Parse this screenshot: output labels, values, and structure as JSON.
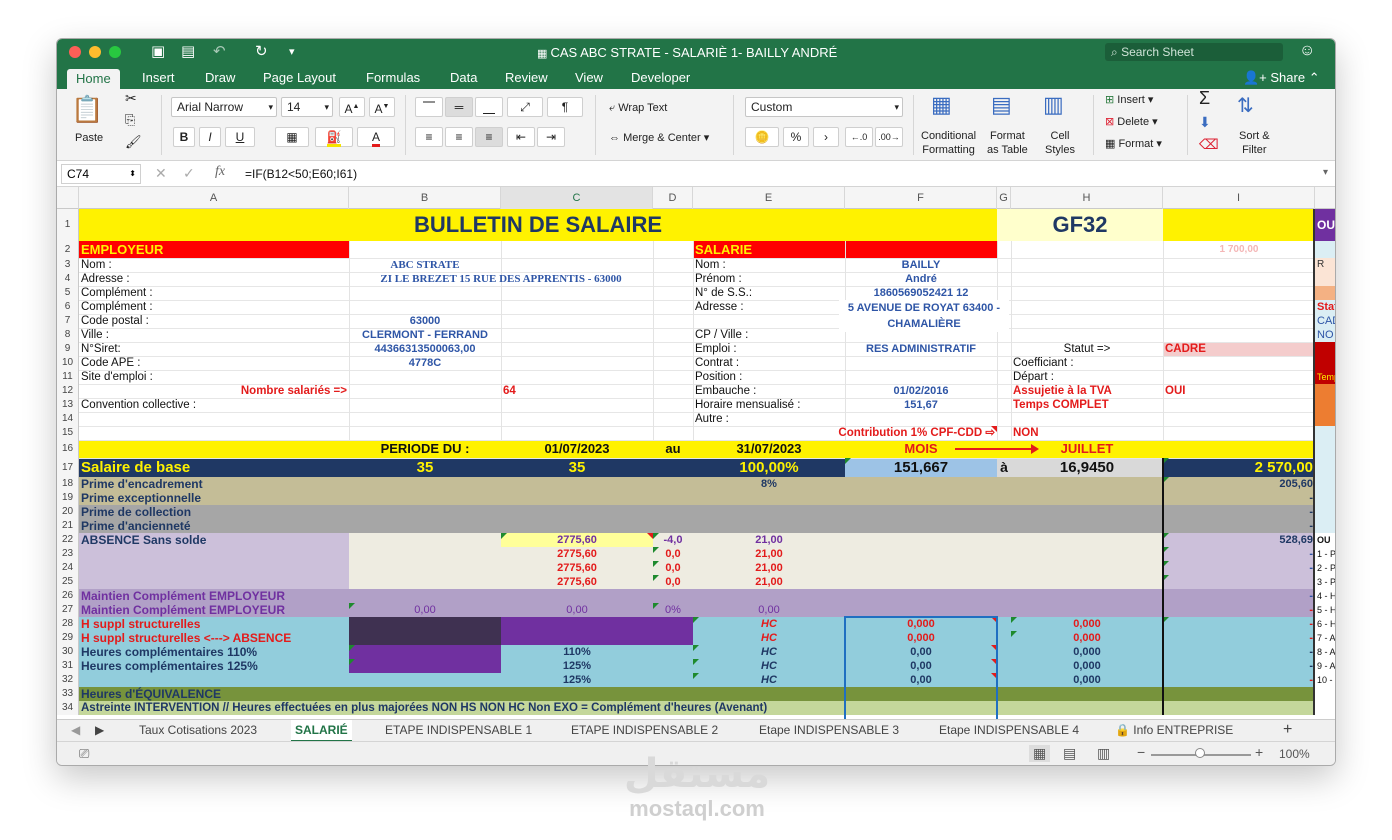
{
  "window": {
    "title": "CAS ABC STRATE - SALARIÈ 1- BAILLY ANDRÉ",
    "search_placeholder": "Search Sheet",
    "share_label": "Share"
  },
  "ribbon_tabs": [
    "Home",
    "Insert",
    "Draw",
    "Page Layout",
    "Formulas",
    "Data",
    "Review",
    "View",
    "Developer"
  ],
  "ribbon": {
    "paste": "Paste",
    "font_name": "Arial Narrow",
    "font_size": "14",
    "bold": "B",
    "italic": "I",
    "underline": "U",
    "wrap_text": "Wrap Text",
    "merge_center": "Merge & Center",
    "number_format": "Custom",
    "percent": "%",
    "comma": "›",
    "cond_formatting_1": "Conditional",
    "cond_formatting_2": "Formatting",
    "format_table_1": "Format",
    "format_table_2": "as Table",
    "cell_styles_1": "Cell",
    "cell_styles_2": "Styles",
    "insert": "Insert",
    "delete": "Delete",
    "format": "Format",
    "sort_filter_1": "Sort &",
    "sort_filter_2": "Filter"
  },
  "formula_bar": {
    "name_box": "C74",
    "fx": "fx",
    "formula": "=IF(B12<50;E60;I61)"
  },
  "columns": [
    "A",
    "B",
    "C",
    "D",
    "E",
    "F",
    "G",
    "H",
    "I"
  ],
  "rows": [
    "1",
    "2",
    "3",
    "4",
    "5",
    "6",
    "7",
    "8",
    "9",
    "10",
    "11",
    "12",
    "13",
    "14",
    "15",
    "16",
    "17",
    "18",
    "19",
    "20",
    "21",
    "22",
    "23",
    "24",
    "25",
    "26",
    "27",
    "28",
    "29",
    "30",
    "31",
    "32",
    "33",
    "34"
  ],
  "sheet": {
    "title": "BULLETIN DE SALAIRE",
    "code": "GF32",
    "right_edge": {
      "r1": "OU",
      "r3": "R",
      "r6": "Stat",
      "r7": "CAD",
      "r8": "NO",
      "r11": "Temps C",
      "r22": "OU",
      "r23": "1 - P",
      "r24": "2 - P",
      "r25": "3 - P",
      "r26": "4 - H",
      "r27": "5 - H",
      "r28": "6 - H",
      "r29": "7 - A",
      "r30": "8 - A",
      "r31": "9 - A",
      "r32": "10 -"
    },
    "employeur": "EMPLOYEUR",
    "salarie": "SALARIE",
    "amount_top": "1 700,00",
    "labels_left": [
      "Nom :",
      "Adresse :",
      "Complément :",
      "Complément :",
      "Code postal :",
      "Ville :",
      "N°Siret:",
      "Code APE :",
      "Site d'emploi :"
    ],
    "nb_salaries_label": "Nombre salariés =>",
    "nb_salaries": "64",
    "convention": "Convention collective :",
    "company_name": "ABC STRATE",
    "company_address": "ZI LE BREZET 15 RUE DES APPRENTIS - 63000",
    "company_cp": "63000",
    "company_city": "CLERMONT - FERRAND",
    "company_siret": "44366313500063,00",
    "company_ape": "4778C",
    "labels_mid": [
      "Nom :",
      "Prénom :",
      "N° de S.S.:",
      "Adresse :",
      "",
      "CP / Ville :",
      "Emploi :",
      "Contrat :",
      "Position :",
      "Embauche :",
      "Horaire mensualisé :",
      "Autre :"
    ],
    "emp_nom": "BAILLY",
    "emp_prenom": "André",
    "emp_ss": "1860569052421 12",
    "emp_addr_1": "5 AVENUE DE ROYAT 63400 -",
    "emp_addr_2": "CHAMALIÈRE",
    "emp_emploi": "RES ADMINISTRATIF",
    "emp_embauche": "01/02/2016",
    "emp_horaire": "151,67",
    "statut_label": "Statut =>",
    "statut": "CADRE",
    "coefficient": "Coefficiant :",
    "depart": "Départ :",
    "tva_label": "Assujetie à la TVA",
    "tva": "OUI",
    "temps": "Temps COMPLET",
    "contribution": "Contribution 1% CPF-CDD ⇨",
    "non": "NON",
    "periode_label": "PERIODE DU :",
    "periode_start": "01/07/2023",
    "periode_au": "au",
    "periode_end": "31/07/2023",
    "mois_label": "MOIS",
    "mois": "JUILLET",
    "salaire_label": "Salaire de base",
    "salaire_b": "35",
    "salaire_c": "35",
    "salaire_pct": "100,00%",
    "salaire_hours": "151,667",
    "salaire_a": "à",
    "salaire_rate": "16,9450",
    "salaire_total": "2 570,00",
    "r18_label": "Prime d'encadrement",
    "r18_pct": "8%",
    "r18_val": "205,60",
    "r19_label": "Prime exceptionnelle",
    "r20_label": "Prime de collection",
    "r21_label": "Prime d'ancienneté",
    "r22_label": "ABSENCE Sans solde",
    "dash": "-",
    "abs_c": [
      "2775,60",
      "2775,60",
      "2775,60",
      "2775,60"
    ],
    "abs_d": [
      "-4,0",
      "0,0",
      "0,0",
      "0,0"
    ],
    "abs_e": [
      "21,00",
      "21,00",
      "21,00",
      "21,00"
    ],
    "r22_val": "528,69",
    "r26_label": "Maintien Complément EMPLOYEUR",
    "r27_label": "Maintien Complément EMPLOYEUR",
    "r27_b": "0,00",
    "r27_c": "0,00",
    "r27_d": "0%",
    "r27_e": "0,00",
    "r28_label": "H suppl structurelles",
    "r29_label": "H suppl structurelles <---> ABSENCE",
    "r30_label": "Heures complémentaires 110%",
    "r31_label": "Heures complémentaires 125%",
    "hc": "HC",
    "r30_c": "110%",
    "r31_c": "125%",
    "r32_c": "125%",
    "f_vals": [
      "0,000",
      "0,000",
      "0,00",
      "0,00",
      "0,00"
    ],
    "h_vals": [
      "0,000",
      "0,000",
      "0,000",
      "0,000",
      "0,000"
    ],
    "r33_label": "Heures d'ÉQUIVALENCE",
    "r34_label": "Astreinte INTERVENTION // Heures effectuées en plus majorées NON HS NON HC Non EXO = Complément d'heures (Avenant)"
  },
  "sheet_tabs": [
    "Taux Cotisations 2023",
    "SALARIÉ",
    "ETAPE INDISPENSABLE 1",
    "ETAPE INDISPENSABLE 2",
    "Etape INDISPENSABLE 3",
    "Etape INDISPENSABLE 4",
    "Info ENTREPRISE"
  ],
  "status": {
    "zoom": "100%",
    "minus": "−",
    "plus": "+"
  },
  "watermark": {
    "arabic": "مستقل",
    "latin": "mostaql.com"
  }
}
